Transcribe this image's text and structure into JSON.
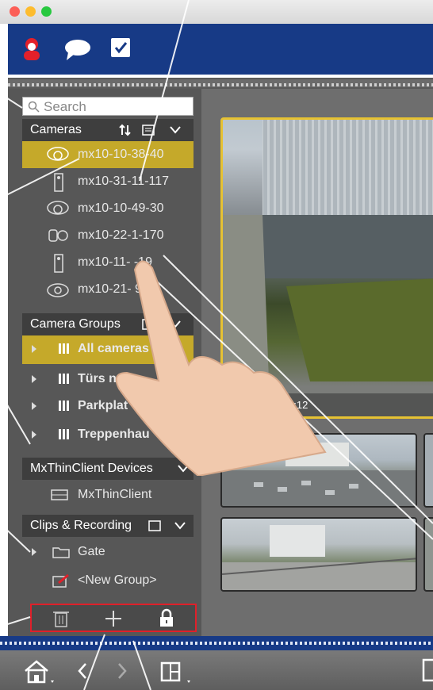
{
  "toolbar": {
    "icons": [
      "user-alert-icon",
      "chat-icon",
      "checkbox-icon"
    ]
  },
  "search": {
    "placeholder": "Search"
  },
  "cameras": {
    "header": "Cameras",
    "items": [
      {
        "label": "mx10-10-38-40",
        "icon": "dome-camera-icon",
        "selected": true
      },
      {
        "label": "mx10-31-11-117",
        "icon": "door-station-icon",
        "selected": false
      },
      {
        "label": "mx10-10-49-30",
        "icon": "dome-camera-icon",
        "selected": false
      },
      {
        "label": "mx10-22-1-170",
        "icon": "dual-camera-icon",
        "selected": false
      },
      {
        "label": "mx10-11-  -19",
        "icon": "door-station-icon",
        "selected": false
      },
      {
        "label": "mx10-21-  91",
        "icon": "hemispheric-camera-icon",
        "selected": false
      }
    ]
  },
  "camera_groups": {
    "header": "Camera Groups",
    "items": [
      {
        "label": "All cameras",
        "selected": true
      },
      {
        "label": "Türs  nen",
        "selected": false
      },
      {
        "label": "Parkplat",
        "selected": false
      },
      {
        "label": "Treppenhau",
        "selected": false
      }
    ]
  },
  "thin_client": {
    "header": "MxThinClient Devices",
    "items": [
      {
        "label": "MxThinClient"
      }
    ]
  },
  "clips": {
    "header": "Clips & Recording",
    "items": [
      {
        "label": "Gate"
      },
      {
        "label": "<New Group>"
      }
    ]
  },
  "video": {
    "timestamp": "8:10:12"
  },
  "colors": {
    "accent_blue": "#173a86",
    "selection_gold": "#c5a92a",
    "highlight_red": "#e0202a",
    "panel_gray": "#575757"
  }
}
